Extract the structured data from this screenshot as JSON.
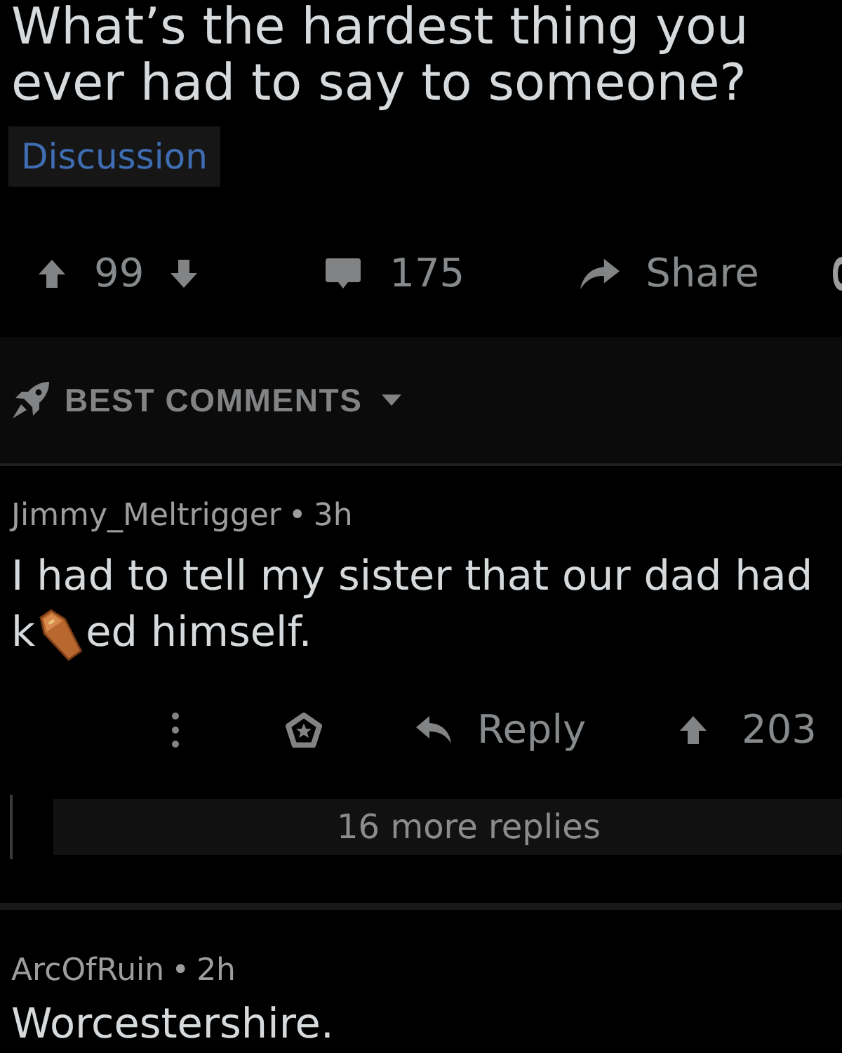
{
  "post": {
    "title": "What’s the hardest thing you ever had to say to someone?",
    "flair": "Discussion"
  },
  "post_actions": {
    "score": "99",
    "comments": "175",
    "share": "Share"
  },
  "sort": {
    "label": "BEST COMMENTS"
  },
  "comments": [
    {
      "author": "Jimmy_Meltrigger",
      "separator": "•",
      "age": "3h",
      "body": [
        {
          "kind": "text",
          "text": "I had to tell my sister that our dad had"
        },
        {
          "kind": "text",
          "text": "k"
        },
        {
          "kind": "sticker"
        },
        {
          "kind": "text",
          "text": "ed himself."
        }
      ],
      "actions": {
        "reply": "Reply",
        "score": "203"
      },
      "more_replies": "16 more replies"
    },
    {
      "author": "ArcOfRuin",
      "separator": "•",
      "age": "2h",
      "body": [
        {
          "kind": "text",
          "text": "Worcestershire."
        }
      ]
    }
  ]
}
